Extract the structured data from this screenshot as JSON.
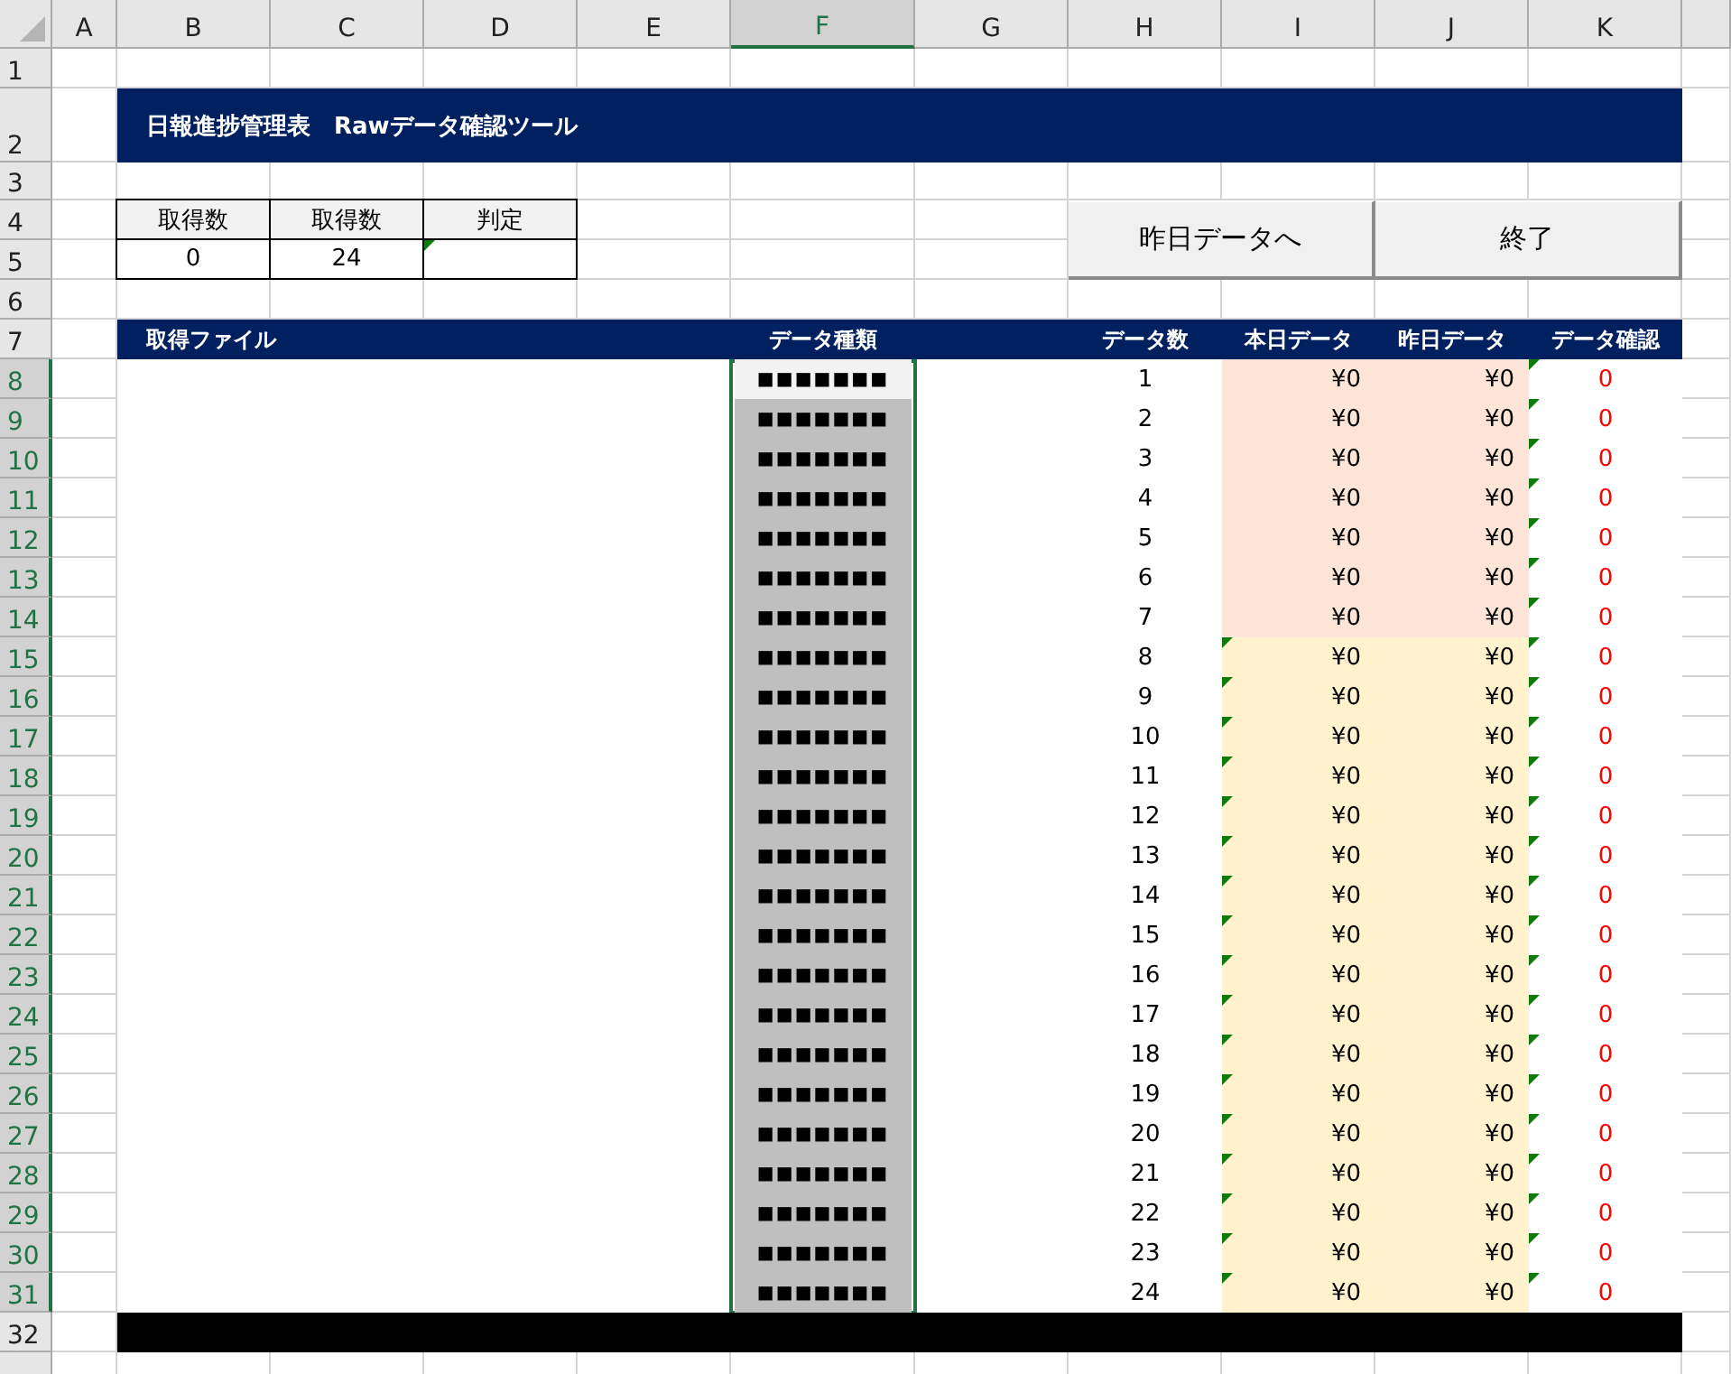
{
  "column_headers": [
    {
      "label": "A",
      "selected": false
    },
    {
      "label": "B",
      "selected": false
    },
    {
      "label": "C",
      "selected": false
    },
    {
      "label": "D",
      "selected": false
    },
    {
      "label": "E",
      "selected": false
    },
    {
      "label": "F",
      "selected": true
    },
    {
      "label": "G",
      "selected": false
    },
    {
      "label": "H",
      "selected": false
    },
    {
      "label": "I",
      "selected": false
    },
    {
      "label": "J",
      "selected": false
    },
    {
      "label": "K",
      "selected": false
    }
  ],
  "row_headers": [
    {
      "label": "1",
      "selected": false
    },
    {
      "label": "2",
      "selected": false
    },
    {
      "label": "3",
      "selected": false
    },
    {
      "label": "4",
      "selected": false
    },
    {
      "label": "5",
      "selected": false
    },
    {
      "label": "6",
      "selected": false
    },
    {
      "label": "7",
      "selected": false
    },
    {
      "label": "8",
      "selected": true
    },
    {
      "label": "9",
      "selected": true
    },
    {
      "label": "10",
      "selected": true
    },
    {
      "label": "11",
      "selected": true
    },
    {
      "label": "12",
      "selected": true
    },
    {
      "label": "13",
      "selected": true
    },
    {
      "label": "14",
      "selected": true
    },
    {
      "label": "15",
      "selected": true
    },
    {
      "label": "16",
      "selected": true
    },
    {
      "label": "17",
      "selected": true
    },
    {
      "label": "18",
      "selected": true
    },
    {
      "label": "19",
      "selected": true
    },
    {
      "label": "20",
      "selected": true
    },
    {
      "label": "21",
      "selected": true
    },
    {
      "label": "22",
      "selected": true
    },
    {
      "label": "23",
      "selected": true
    },
    {
      "label": "24",
      "selected": true
    },
    {
      "label": "25",
      "selected": true
    },
    {
      "label": "26",
      "selected": true
    },
    {
      "label": "27",
      "selected": true
    },
    {
      "label": "28",
      "selected": true
    },
    {
      "label": "29",
      "selected": true
    },
    {
      "label": "30",
      "selected": true
    },
    {
      "label": "31",
      "selected": true
    },
    {
      "label": "32",
      "selected": false
    }
  ],
  "title": "日報進捗管理表　Rawデータ確認ツール",
  "summary": [
    {
      "header": "取得数",
      "value": "0",
      "error_marker": false
    },
    {
      "header": "取得数",
      "value": "24",
      "error_marker": false
    },
    {
      "header": "判定",
      "error_marker": true
    }
  ],
  "buttons": [
    "昨日データへ",
    "終了"
  ],
  "data_table": {
    "columns": [
      "取得ファイル",
      "データ種類",
      "データ数",
      "本日データ",
      "昨日データ",
      "データ確認"
    ],
    "rows": [
      {
        "type": "■■■■■■■",
        "active": true,
        "count": "1",
        "today": "¥0",
        "yesterday": "¥0",
        "check": "0",
        "color": "#fce4d6",
        "today_marker": false,
        "check_marker": true
      },
      {
        "type": "■■■■■■■",
        "active": false,
        "count": "2",
        "today": "¥0",
        "yesterday": "¥0",
        "check": "0",
        "color": "#fce4d6",
        "today_marker": false,
        "check_marker": true
      },
      {
        "type": "■■■■■■■",
        "active": false,
        "count": "3",
        "today": "¥0",
        "yesterday": "¥0",
        "check": "0",
        "color": "#fce4d6",
        "today_marker": false,
        "check_marker": true
      },
      {
        "type": "■■■■■■■",
        "active": false,
        "count": "4",
        "today": "¥0",
        "yesterday": "¥0",
        "check": "0",
        "color": "#fce4d6",
        "today_marker": false,
        "check_marker": true
      },
      {
        "type": "■■■■■■■",
        "active": false,
        "count": "5",
        "today": "¥0",
        "yesterday": "¥0",
        "check": "0",
        "color": "#fce4d6",
        "today_marker": false,
        "check_marker": true
      },
      {
        "type": "■■■■■■■",
        "active": false,
        "count": "6",
        "today": "¥0",
        "yesterday": "¥0",
        "check": "0",
        "color": "#fce4d6",
        "today_marker": false,
        "check_marker": true
      },
      {
        "type": "■■■■■■■",
        "active": false,
        "count": "7",
        "today": "¥0",
        "yesterday": "¥0",
        "check": "0",
        "color": "#fce4d6",
        "today_marker": false,
        "check_marker": true
      },
      {
        "type": "■■■■■■■",
        "active": false,
        "count": "8",
        "today": "¥0",
        "yesterday": "¥0",
        "check": "0",
        "color": "#fff2cc",
        "today_marker": true,
        "check_marker": true
      },
      {
        "type": "■■■■■■■",
        "active": false,
        "count": "9",
        "today": "¥0",
        "yesterday": "¥0",
        "check": "0",
        "color": "#fff2cc",
        "today_marker": true,
        "check_marker": true
      },
      {
        "type": "■■■■■■■",
        "active": false,
        "count": "10",
        "today": "¥0",
        "yesterday": "¥0",
        "check": "0",
        "color": "#fff2cc",
        "today_marker": true,
        "check_marker": true
      },
      {
        "type": "■■■■■■■",
        "active": false,
        "count": "11",
        "today": "¥0",
        "yesterday": "¥0",
        "check": "0",
        "color": "#fff2cc",
        "today_marker": true,
        "check_marker": true
      },
      {
        "type": "■■■■■■■",
        "active": false,
        "count": "12",
        "today": "¥0",
        "yesterday": "¥0",
        "check": "0",
        "color": "#fff2cc",
        "today_marker": true,
        "check_marker": true
      },
      {
        "type": "■■■■■■■",
        "active": false,
        "count": "13",
        "today": "¥0",
        "yesterday": "¥0",
        "check": "0",
        "color": "#fff2cc",
        "today_marker": true,
        "check_marker": true
      },
      {
        "type": "■■■■■■■",
        "active": false,
        "count": "14",
        "today": "¥0",
        "yesterday": "¥0",
        "check": "0",
        "color": "#fff2cc",
        "today_marker": true,
        "check_marker": true
      },
      {
        "type": "■■■■■■■",
        "active": false,
        "count": "15",
        "today": "¥0",
        "yesterday": "¥0",
        "check": "0",
        "color": "#fff2cc",
        "today_marker": true,
        "check_marker": true
      },
      {
        "type": "■■■■■■■",
        "active": false,
        "count": "16",
        "today": "¥0",
        "yesterday": "¥0",
        "check": "0",
        "color": "#fff2cc",
        "today_marker": true,
        "check_marker": true
      },
      {
        "type": "■■■■■■■",
        "active": false,
        "count": "17",
        "today": "¥0",
        "yesterday": "¥0",
        "check": "0",
        "color": "#fff2cc",
        "today_marker": true,
        "check_marker": true
      },
      {
        "type": "■■■■■■■",
        "active": false,
        "count": "18",
        "today": "¥0",
        "yesterday": "¥0",
        "check": "0",
        "color": "#fff2cc",
        "today_marker": true,
        "check_marker": true
      },
      {
        "type": "■■■■■■■",
        "active": false,
        "count": "19",
        "today": "¥0",
        "yesterday": "¥0",
        "check": "0",
        "color": "#fff2cc",
        "today_marker": true,
        "check_marker": true
      },
      {
        "type": "■■■■■■■",
        "active": false,
        "count": "20",
        "today": "¥0",
        "yesterday": "¥0",
        "check": "0",
        "color": "#fff2cc",
        "today_marker": true,
        "check_marker": true
      },
      {
        "type": "■■■■■■■",
        "active": false,
        "count": "21",
        "today": "¥0",
        "yesterday": "¥0",
        "check": "0",
        "color": "#fff2cc",
        "today_marker": true,
        "check_marker": true
      },
      {
        "type": "■■■■■■■",
        "active": false,
        "count": "22",
        "today": "¥0",
        "yesterday": "¥0",
        "check": "0",
        "color": "#fff2cc",
        "today_marker": true,
        "check_marker": true
      },
      {
        "type": "■■■■■■■",
        "active": false,
        "count": "23",
        "today": "¥0",
        "yesterday": "¥0",
        "check": "0",
        "color": "#fff2cc",
        "today_marker": true,
        "check_marker": true
      },
      {
        "type": "■■■■■■■",
        "active": false,
        "count": "24",
        "today": "¥0",
        "yesterday": "¥0",
        "check": "0",
        "color": "#fff2cc",
        "today_marker": true,
        "check_marker": true
      }
    ]
  }
}
